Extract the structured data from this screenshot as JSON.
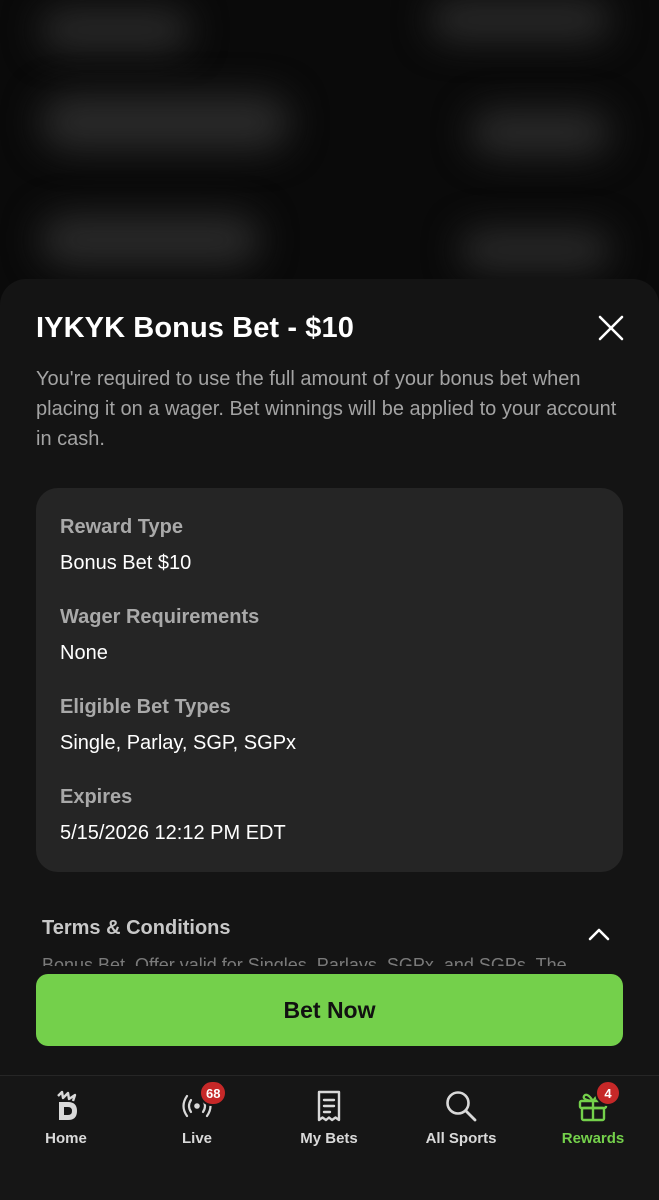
{
  "sheet": {
    "title": "IYKYK Bonus Bet - $10",
    "description": "You're required to use the full amount of your bonus bet when placing it on a wager. Bet winnings will be applied to your account in cash."
  },
  "details": [
    {
      "label": "Reward Type",
      "value": "Bonus Bet $10"
    },
    {
      "label": "Wager Requirements",
      "value": "None"
    },
    {
      "label": "Eligible Bet Types",
      "value": "Single, Parlay, SGP, SGPx"
    },
    {
      "label": "Expires",
      "value": "5/15/2026 12:12 PM EDT"
    }
  ],
  "terms": {
    "title": "Terms & Conditions",
    "preview": "Bonus Bet. Offer valid for Singles, Parlays, SGPx, and SGPs. The"
  },
  "cta": {
    "label": "Bet Now"
  },
  "nav": {
    "items": [
      {
        "label": "Home",
        "icon": "draftkings-logo-icon"
      },
      {
        "label": "Live",
        "icon": "live-broadcast-icon",
        "badge": "68"
      },
      {
        "label": "My Bets",
        "icon": "receipt-icon"
      },
      {
        "label": "All Sports",
        "icon": "search-icon"
      },
      {
        "label": "Rewards",
        "icon": "gift-icon",
        "badge": "4"
      }
    ],
    "active": "Rewards"
  },
  "colors": {
    "accent": "#74d04b",
    "badge": "#c62828",
    "sheet": "#141414",
    "card": "#252525"
  }
}
